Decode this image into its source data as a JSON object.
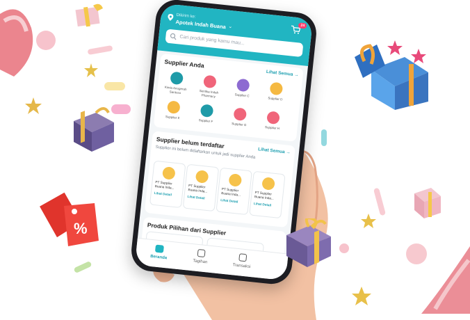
{
  "header": {
    "location_label": "Dikirim ke:",
    "location_name": "Apotek Indah Buana",
    "cart_count": "24"
  },
  "search": {
    "placeholder": "Cari produk yang kamu mau..."
  },
  "suppliers": {
    "title": "Supplier Anda",
    "see_all": "Lihat Semua",
    "items": [
      {
        "label": "Kimia Anugerah Santoso",
        "color": "#1f9ba8"
      },
      {
        "label": "Sentika Indah Pharmacy",
        "color": "#f0657a"
      },
      {
        "label": "Supplier C",
        "color": "#8d6bd1"
      },
      {
        "label": "Supplier D",
        "color": "#f5b942"
      },
      {
        "label": "Supplier E",
        "color": "#f5b942"
      },
      {
        "label": "Supplier F",
        "color": "#1f9ba8"
      },
      {
        "label": "Supplier G",
        "color": "#f0657a"
      },
      {
        "label": "Supplier H",
        "color": "#f0657a"
      }
    ]
  },
  "unregistered": {
    "title": "Supplier belum terdaftar",
    "see_all": "Lihat Semua",
    "subtitle": "Supplier ini belum didaftarkan untuk jadi supplier Anda",
    "cards": [
      {
        "name": "PT Supplier Buana Inda...",
        "link": "Lihat Detail"
      },
      {
        "name": "PT Supplier Buana Inda...",
        "link": "Lihat Detail"
      },
      {
        "name": "PT Supplier Buana Inda...",
        "link": "Lihat Detail"
      },
      {
        "name": "PT Supplier Buana Inda...",
        "link": "Lihat Detail"
      }
    ]
  },
  "featured": {
    "title": "Produk Pilihan dari Supplier"
  },
  "nav": {
    "items": [
      {
        "label": "Beranda"
      },
      {
        "label": "Tagihan"
      },
      {
        "label": "Transaksi"
      }
    ]
  },
  "colors": {
    "primary": "#21b5c2",
    "accent": "#1d9fb0",
    "badge": "#ff3b6b"
  }
}
